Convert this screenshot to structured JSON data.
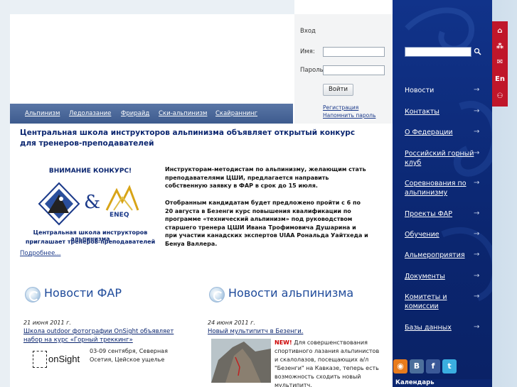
{
  "login": {
    "title": "Вход",
    "username_label": "Имя:",
    "password_label": "Пароль:",
    "button_label": "Войти",
    "register_link": "Регистрация",
    "remind_link": "Напомнить пароль"
  },
  "nav": {
    "items": [
      "Альпинизм",
      "Ледолазание",
      "Фрирайд",
      "Ски-альпинизм",
      "Скайраннинг"
    ]
  },
  "article": {
    "title": "Центральная школа инструкторов альпинизма объявляет открытый конкурс для тренеров-преподавателей",
    "banner_heading": "ВНИМАНИЕ КОНКУРС!",
    "banner_ampersand": "&",
    "banner_logo_text": "ENEQ",
    "banner_caption_1": "Центральная школа инструкторов альпинизма",
    "banner_caption_2": "приглашает тренеров-преподавателей",
    "more_link": "Подробнее...",
    "paragraph_1": "Инструкторам-методистам по альпинизму, желающим стать преподавателями ЦШИ, предлагается направить собственную заявку в ФАР в срок до 15 июля.",
    "paragraph_2": "Отобранным кандидатам будет предложено пройти с 6 по 20 августа в Безенги курс повышения квалификации по программе «технический альпинизм» под руководством старшего тренера ЦШИ Ивана Трофимовича Душарина и при участии канадских экспертов UIAA Рональда Уайтхеда и Бенуа Валлера."
  },
  "news_far": {
    "title": "Новости ФАР",
    "date": "21 июня 2011 г.",
    "link": "Школа outdoor фотографии OnSight объявляет набор на курс «Горный треккинг»",
    "logo_text": "onSight",
    "description": "03-09 сентября, Северная Осетия, Цейское ущелье"
  },
  "news_alp": {
    "title": "Новости альпинизма",
    "date": "24 июня 2011 г.",
    "link": "Новый мультипитч в Безенги.",
    "new_badge": "NEW!",
    "description": "Для совершенствования спортивного лазания альпинистов и скалолазов, посещающих а/л \"Безенги\" на Кавказе, теперь есть возможность сходить новый мультипитч."
  },
  "sidebar": {
    "menu": [
      "Новости",
      "Контакты",
      "О Федерации",
      "Российский горный клуб",
      "Соревнования по альпинизму",
      "Проекты ФАР",
      "Обучение",
      "Альмероприятия",
      "Документы",
      "Комитеты и комиссии",
      "Базы данных"
    ],
    "arrow": "→",
    "calendar_label": "Календарь"
  },
  "top_icons": {
    "lang": "En"
  },
  "colors": {
    "sidebar": "#0b2670",
    "nav": "#4a679a",
    "accent_red": "#c0162a",
    "link": "#0b2670"
  }
}
